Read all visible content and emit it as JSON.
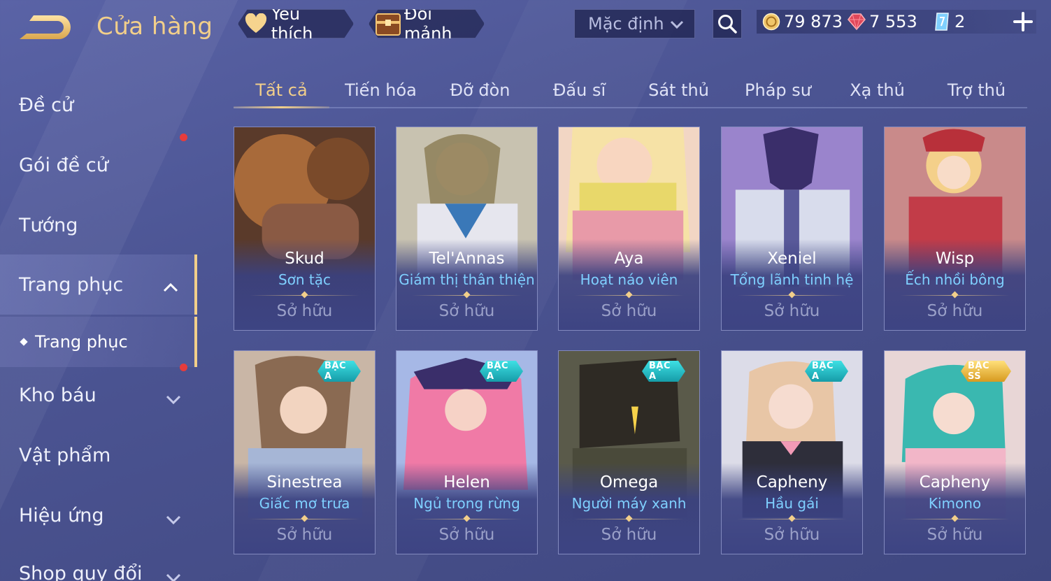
{
  "header": {
    "title": "Cửa hàng",
    "favorites_label": "Yêu thích",
    "shard_exchange_label": "Đổi mảnh",
    "sort_value": "Mặc định"
  },
  "currency": {
    "gold": "79 873",
    "gems": "7 553",
    "tickets": "2"
  },
  "sidebar": {
    "items": [
      {
        "label": "Đề cử"
      },
      {
        "label": "Gói đề cử"
      },
      {
        "label": "Tướng"
      },
      {
        "label": "Trang phục"
      },
      {
        "label": "Trang phục"
      },
      {
        "label": "Kho báu"
      },
      {
        "label": "Vật phẩm"
      },
      {
        "label": "Hiệu ứng"
      },
      {
        "label": "Shop quy đổi"
      }
    ]
  },
  "tabs": [
    {
      "label": "Tất cả"
    },
    {
      "label": "Tiến hóa"
    },
    {
      "label": "Đỡ đòn"
    },
    {
      "label": "Đấu sĩ"
    },
    {
      "label": "Sát thủ"
    },
    {
      "label": "Pháp sư"
    },
    {
      "label": "Xạ thủ"
    },
    {
      "label": "Trợ thủ"
    }
  ],
  "cards": [
    {
      "hero": "Skud",
      "skin": "Sơn tặc",
      "status": "Sở hữu",
      "badge": ""
    },
    {
      "hero": "Tel'Annas",
      "skin": "Giám thị thân thiện",
      "status": "Sở hữu",
      "badge": ""
    },
    {
      "hero": "Aya",
      "skin": "Hoạt náo viên",
      "status": "Sở hữu",
      "badge": ""
    },
    {
      "hero": "Xeniel",
      "skin": "Tổng lãnh tinh hệ",
      "status": "Sở hữu",
      "badge": ""
    },
    {
      "hero": "Wisp",
      "skin": "Ếch nhồi bông",
      "status": "Sở hữu",
      "badge": ""
    },
    {
      "hero": "Sinestrea",
      "skin": "Giấc mơ trưa",
      "status": "Sở hữu",
      "badge": "BẬC A"
    },
    {
      "hero": "Helen",
      "skin": "Ngủ trong rừng",
      "status": "Sở hữu",
      "badge": "BẬC A"
    },
    {
      "hero": "Omega",
      "skin": "Người máy xanh",
      "status": "Sở hữu",
      "badge": "BẬC A"
    },
    {
      "hero": "Capheny",
      "skin": "Hầu gái",
      "status": "Sở hữu",
      "badge": "BẬC A"
    },
    {
      "hero": "Capheny",
      "skin": "Kimono",
      "status": "Sở hữu",
      "badge": "BẬC SS"
    }
  ]
}
